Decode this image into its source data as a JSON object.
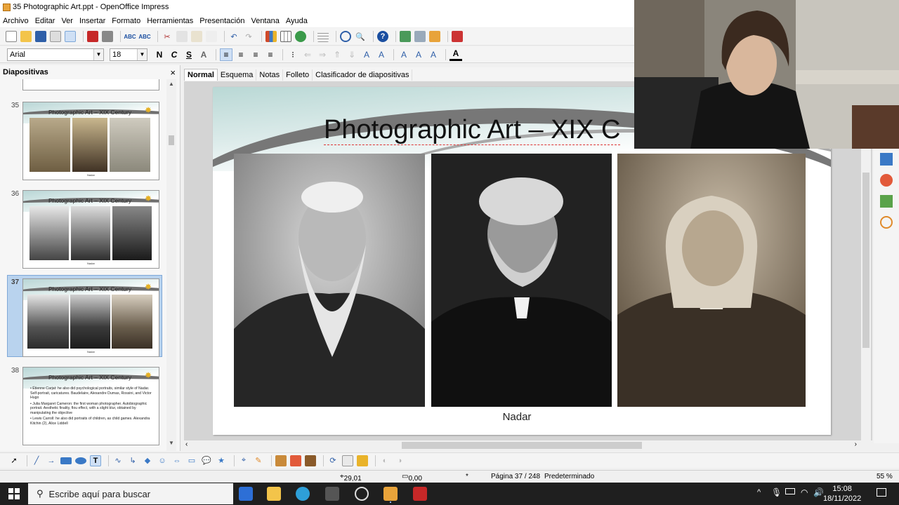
{
  "window": {
    "title": "35 Photographic Art.ppt - OpenOffice Impress"
  },
  "menu": [
    "Archivo",
    "Editar",
    "Ver",
    "Insertar",
    "Formato",
    "Herramientas",
    "Presentación",
    "Ventana",
    "Ayuda"
  ],
  "format": {
    "font_name": "Arial",
    "font_size": "18"
  },
  "side_panel": {
    "title": "Diapositivas",
    "close": "×",
    "slides": [
      {
        "number": "35",
        "title": "Photographic Art – XIX Century",
        "caption": "Nadar"
      },
      {
        "number": "36",
        "title": "Photographic Art – XIX Century",
        "caption": "Nadar"
      },
      {
        "number": "37",
        "title": "Photographic Art – XIX Century",
        "caption": "Nadar"
      },
      {
        "number": "38",
        "title": "Photographic Art – XIX Century",
        "bullets": [
          "Étienne Carjat: he also did psychological portraits, similar style of Nadar. Self-portrait, caricatures. Baudelaire, Alexandre Dumas, Rossini, and Victor Hugo",
          "Julia Margaret Cameron: the first woman photographer. Autobiographic portrait. Aesthetic finality, flou effect, with a slight blur, obtained by manipulating the objective",
          "Lewis Carroll: he also did portraits of children, as child games. Alexandra Kitchin (2), Alice Liddell"
        ]
      }
    ]
  },
  "view_tabs": [
    "Normal",
    "Esquema",
    "Notas",
    "Folleto",
    "Clasificador de diapositivas"
  ],
  "slide": {
    "title": "Photographic Art – XIX C",
    "caption": "Nadar"
  },
  "status": {
    "position": "29,01 / 15,68",
    "size": "0,00 x 0,00",
    "modified": "*",
    "page": "Página 37 / 248",
    "layout": "Predeterminado",
    "zoom": "55 %"
  },
  "taskbar": {
    "search_placeholder": "Escribe aquí para buscar",
    "time": "15:08",
    "date": "18/11/2022"
  },
  "icons": [
    "new-icon",
    "open-icon",
    "save-icon",
    "email-icon",
    "edit-icon",
    "pdf-icon",
    "print-icon",
    "spellcheck-icon",
    "cut-icon",
    "copy-icon",
    "paste-icon",
    "undo-icon",
    "redo-icon",
    "chart-icon",
    "table-icon",
    "navigator-icon",
    "zoom-icon",
    "help-icon",
    "windows-start-icon",
    "search-icon"
  ],
  "colors": {
    "accent_selected": "#b9d3ee",
    "taskbar": "#1f1f1f",
    "slide_swoosh": "#777777",
    "slide_teal": "#b9d8d5"
  }
}
